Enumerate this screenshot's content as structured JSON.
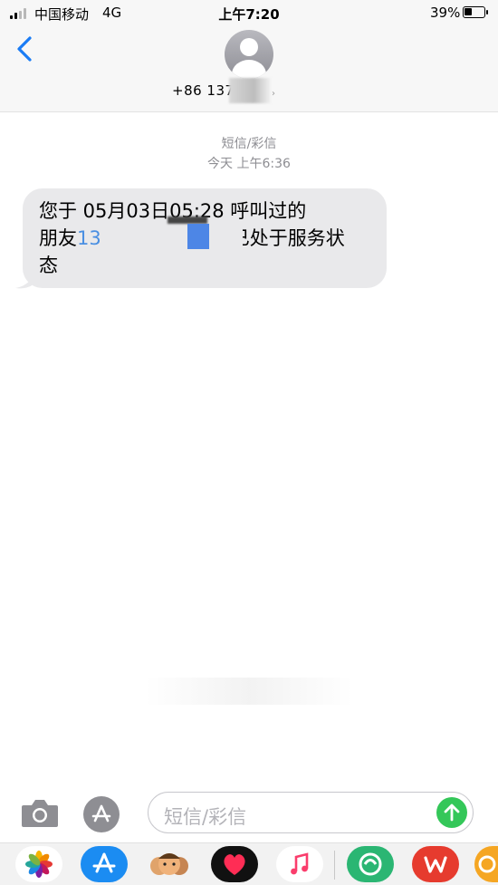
{
  "status_bar": {
    "carrier": "中国移动",
    "network": "4G",
    "time": "上午7:20",
    "battery_percent_text": "39%",
    "battery_level": 0.39
  },
  "header": {
    "contact_visible": "+86 137"
  },
  "conversation": {
    "service_label": "短信/彩信",
    "timestamp": "今天 上午6:36",
    "message": {
      "line1": "您于 05月03日05:28 呼叫过的",
      "line2_prefix": "朋友",
      "line2_link": "13",
      "line2_suffix": "已处于服务状",
      "line3": "态"
    }
  },
  "input_bar": {
    "placeholder": "短信/彩信"
  },
  "app_strip": {
    "apps": [
      "photos-icon",
      "app-store-icon",
      "memoji-icon",
      "digital-touch-icon",
      "music-icon",
      "green-app-icon",
      "wps-icon",
      "orange-app-icon"
    ]
  },
  "colors": {
    "link": "#4a8fe2",
    "bubble": "#e9e9eb",
    "send": "#34c759",
    "header_bg": "#f7f7f7",
    "meta_text": "#8e8e93"
  }
}
